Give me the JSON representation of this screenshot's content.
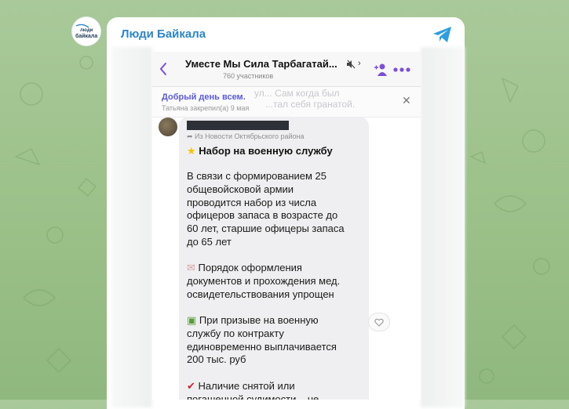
{
  "channel": {
    "name": "Люди Байкала",
    "avatar_text": "люди байкала"
  },
  "screenshot": {
    "header": {
      "title": "Уместе Мы Сила Тарбагатай...",
      "members": "760 участников"
    },
    "pinned": {
      "title": "Добрый день всем.",
      "subtitle": "Татьяна закрепил(а) 9 мая",
      "ghost_line1": "ул... Сам когда был",
      "ghost_line2": "...тал себя гранатой."
    },
    "message": {
      "forwarded_from": "Из Новости Октябрьского района",
      "heading": "Набор на военную службу",
      "paragraph1": "В связи с формированием 25\nобщевойсковой армии\nпроводится набор из числа\nофицеров запаса в возрасте до\n60 лет, старшие офицеры запаса\nдо 65 лет",
      "paragraph2": "Порядок оформления\nдокументов и прохождения мед.\nосвидетельствования упрощен",
      "paragraph3": "При призыве на военную\nслужбу по контракту\nединовременно выплачивается\n200 тыс. руб",
      "paragraph4": "Наличие снятой или\nпогашенной судимости – не"
    }
  },
  "colors": {
    "accent": "#2d86c7",
    "pinned_accent": "#5b5bd6",
    "header_icons": "#7b4fd6"
  }
}
